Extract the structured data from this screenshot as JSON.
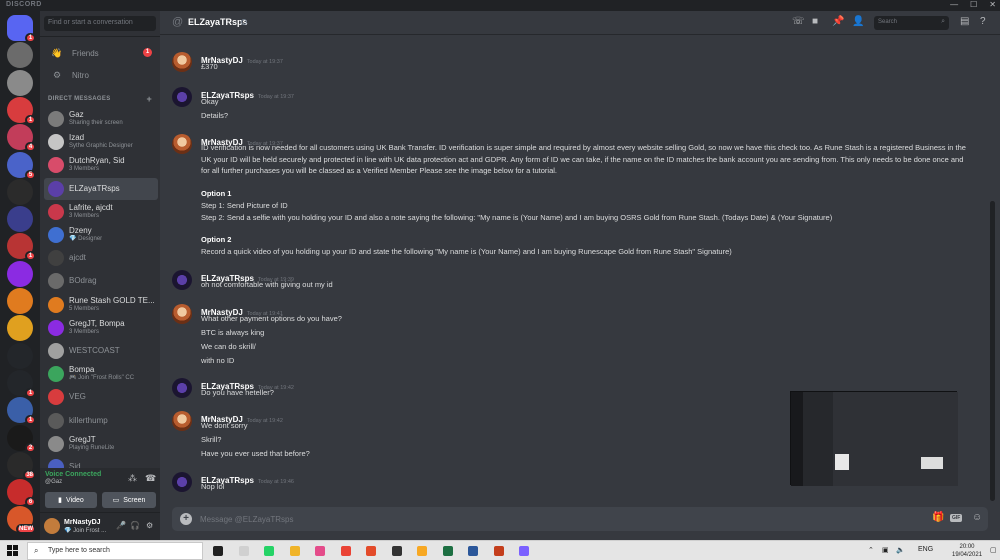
{
  "window": {
    "brand": "DISCORD",
    "controls": [
      "—",
      "☐",
      "✕"
    ]
  },
  "servers": [
    {
      "color": "#5865f2",
      "badge": "1",
      "icon": "discord-home-icon"
    },
    {
      "color": "#6b6b6b",
      "badge": "",
      "icon": "server-avatar"
    },
    {
      "color": "#8a8a8a",
      "badge": "",
      "icon": "server-avatar"
    },
    {
      "color": "#d83c3e",
      "badge": "1",
      "icon": "server-avatar"
    },
    {
      "color": "#c23d5a",
      "badge": "4",
      "icon": "server-avatar"
    },
    {
      "color": "#4a63c9",
      "badge": "5",
      "icon": "server-avatar"
    },
    {
      "color": "#2b2b2b",
      "badge": "",
      "icon": "server-avatar"
    },
    {
      "color": "#3a3e8c",
      "badge": "",
      "icon": "server-avatar"
    },
    {
      "color": "#b83434",
      "badge": "1",
      "icon": "server-avatar"
    },
    {
      "color": "#8b2be2",
      "badge": "",
      "icon": "server-avatar"
    },
    {
      "color": "#e07b1f",
      "badge": "",
      "icon": "server-avatar"
    },
    {
      "color": "#e0a01f",
      "badge": "",
      "icon": "server-avatar"
    },
    {
      "color": "#23262a",
      "badge": "",
      "icon": "server-avatar"
    },
    {
      "color": "#23262a",
      "badge": "1",
      "icon": "server-avatar"
    },
    {
      "color": "#3a5fa8",
      "badge": "1",
      "icon": "server-avatar"
    },
    {
      "color": "#1a1a1a",
      "badge": "2",
      "icon": "server-avatar"
    },
    {
      "color": "#2a2a2a",
      "badge": "38",
      "icon": "server-avatar"
    },
    {
      "color": "#c72c2c",
      "badge": "6",
      "icon": "server-avatar"
    },
    {
      "color": "#d8572a",
      "badge": "NEW",
      "icon": "server-avatar"
    }
  ],
  "sidebar": {
    "search_placeholder": "Find or start a conversation",
    "friends_label": "Friends",
    "friends_badge": "1",
    "nitro_label": "Nitro",
    "dm_header": "DIRECT MESSAGES",
    "dms": [
      {
        "name": "Gaz",
        "sub": "Sharing their screen",
        "color": "#7b7b7b"
      },
      {
        "name": "Izad",
        "sub": "Sythe Graphic Designer",
        "color": "#c5c5c5"
      },
      {
        "name": "DutchRyan, Sid",
        "sub": "3 Members",
        "color": "#d84c6a"
      },
      {
        "name": "ELZayaTRsps",
        "sub": "",
        "color": "#5b3fa8"
      },
      {
        "name": "Lafrite, ajcdt",
        "sub": "3 Members",
        "color": "#c9384b"
      },
      {
        "name": "Dzeny",
        "sub": "💎 Designer",
        "color": "#3f6fd1"
      },
      {
        "name": "ajcdt",
        "sub": "",
        "color": "#404040"
      },
      {
        "name": "BOdrag",
        "sub": "",
        "color": "#6a6a6a"
      },
      {
        "name": "Rune Stash GOLD TE...",
        "sub": "5 Members",
        "color": "#e07b1f"
      },
      {
        "name": "GregJT, Bompa",
        "sub": "3 Members",
        "color": "#8b2be2"
      },
      {
        "name": "WESTCOAST",
        "sub": "",
        "color": "#a0a0a0"
      },
      {
        "name": "Bompa",
        "sub": "🎮 Join \"Frost Rolls\" CC",
        "color": "#3ba55d"
      },
      {
        "name": "VEG",
        "sub": "",
        "color": "#d83c3e"
      },
      {
        "name": "killerthump",
        "sub": "",
        "color": "#5a5a5a"
      },
      {
        "name": "GregJT",
        "sub": "Playing RuneLite",
        "color": "#8a8a8a"
      },
      {
        "name": "Sid",
        "sub": "",
        "color": "#4a5fc0"
      }
    ],
    "voice": {
      "status": "Voice Connected",
      "channel": "@Gaz",
      "video_label": "Video",
      "screen_label": "Screen"
    },
    "user": {
      "name": "MrNastyDJ",
      "status": "💎 Join Frost ..."
    }
  },
  "chat": {
    "title": "ELZayaTRsps",
    "search_placeholder": "Search",
    "composer_placeholder": "Message @ELZayaTRsps",
    "gif_label": "GIF",
    "messages": [
      {
        "author": "MrNastyDJ",
        "time": "Today at 19:37",
        "avatar": "nasty",
        "lines": [
          "£370"
        ]
      },
      {
        "author": "ELZayaTRsps",
        "time": "Today at 19:37",
        "avatar": "zaya",
        "lines": [
          "Okay",
          "Details?"
        ]
      },
      {
        "author": "MrNastyDJ",
        "time": "Today at 19:37",
        "avatar": "nasty",
        "paragraph": "ID verification is now needed for all customers using UK Bank Transfer. ID verification is super simple and required by almost every website selling Gold, so now we have this check too. As Rune Stash is a registered Business in the UK your ID will be held securely and protected in line with UK data protection act and GDPR. Any form of ID we can take, if the name on the ID matches the bank account you are sending from. This only needs to be done once and for all further purchases you will be classed as a Verified Member Please see the image below for a tutorial.",
        "option1_title": "Option 1",
        "option1_lines": [
          "Step 1: Send Picture of ID",
          "Step 2: Send a selfie with you holding your ID and also a note saying the following: \"My name is (Your Name) and I am buying OSRS Gold from Rune Stash. (Todays Date) & (Your Signature)"
        ],
        "option2_title": "Option 2",
        "option2_lines": [
          "Record a quick video of you holding up your ID and state the following \"My name is (Your Name) and I am buying Runescape Gold from Rune Stash\" Signature)"
        ]
      },
      {
        "author": "ELZayaTRsps",
        "time": "Today at 19:39",
        "avatar": "zaya",
        "lines": [
          "oh not comfortable with giving out my id"
        ]
      },
      {
        "author": "MrNastyDJ",
        "time": "Today at 19:41",
        "avatar": "nasty",
        "lines": [
          "What other payment options do you have?",
          "BTC is always king",
          "We can do skrill/",
          "with no ID"
        ]
      },
      {
        "author": "ELZayaTRsps",
        "time": "Today at 19:42",
        "avatar": "zaya",
        "lines": [
          "Do you have neteller?"
        ]
      },
      {
        "author": "MrNastyDJ",
        "time": "Today at 19:42",
        "avatar": "nasty",
        "lines": [
          "We dont sorry",
          "Skrill?",
          "Have you ever used that before?"
        ]
      },
      {
        "author": "ELZayaTRsps",
        "time": "Today at 19:46",
        "avatar": "zaya",
        "lines": [
          "Nop lol"
        ]
      }
    ]
  },
  "taskbar": {
    "search_placeholder": "Type here to search",
    "language": "ENG",
    "time": "20:00",
    "date": "19/04/2021",
    "apps": [
      "#202020",
      "#d0d0d0",
      "#25d366",
      "#f0b429",
      "#e44c8a",
      "#ea4335",
      "#e34b2a",
      "#333333",
      "#f7a823",
      "#1d6f42",
      "#2b579a",
      "#c43e1c",
      "#7b61ff"
    ]
  }
}
